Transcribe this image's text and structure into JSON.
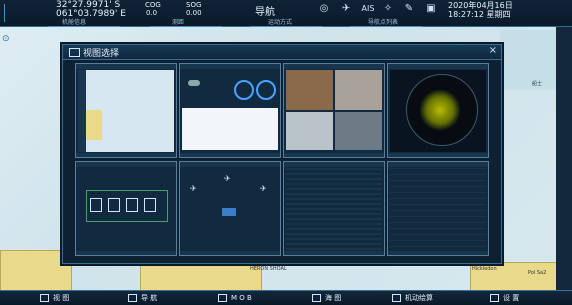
{
  "header": {
    "latitude": "32°27.9971' S",
    "longitude": "061°03.7989' E",
    "cog_label": "COG",
    "cog_value": "0.0",
    "sog_label": "SOG",
    "sog_value": "0.00",
    "title": "导航",
    "ais_label": "AIS",
    "date": "2020年04月16日",
    "time": "18:27:12 星期四",
    "tabs": [
      "机舱信息",
      "测距",
      "运动方式",
      "导航点列表"
    ]
  },
  "dialog": {
    "title": "视图选择",
    "close": "×"
  },
  "bottom_bar": {
    "items": [
      "视 图",
      "导 航",
      "M O B",
      "海 图",
      "机动绘算",
      "设 置"
    ]
  },
  "map_labels": [
    "船士",
    "HERON SHOAL",
    "Hickledon",
    "Pol Sa2"
  ],
  "colors": {
    "accent": "#3a6e92",
    "bar_bg": "#0a1a2a",
    "radar_green": "#e6e600"
  },
  "icons": [
    "compass-icon",
    "satellite-icon",
    "ais-icon",
    "chart-icon",
    "settings-icon",
    "image-icon",
    "view-icon",
    "navigate-icon",
    "mob-icon",
    "sea-chart-icon",
    "maneuver-icon",
    "gear-icon"
  ]
}
